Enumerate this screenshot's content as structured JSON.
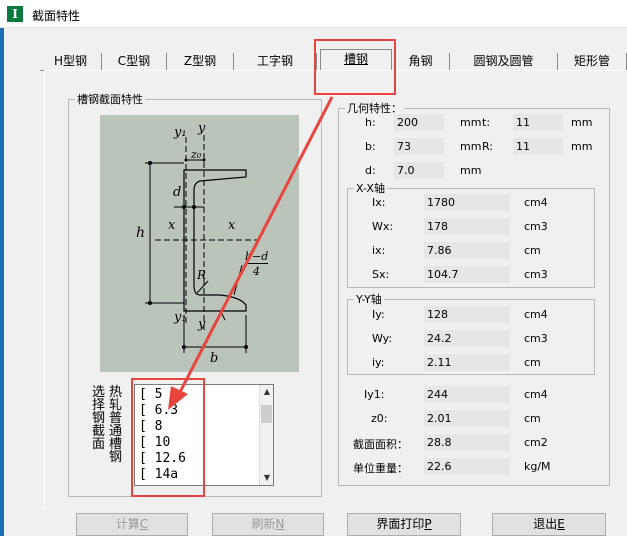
{
  "window": {
    "title": "截面特性",
    "icon_letter": "I"
  },
  "tabs": [
    {
      "label": "H型钢",
      "active": false
    },
    {
      "label": "C型钢",
      "active": false
    },
    {
      "label": "Z型钢",
      "active": false
    },
    {
      "label": "工字钢",
      "active": false
    },
    {
      "label": "槽钢",
      "active": true
    },
    {
      "label": "角钢",
      "active": false
    },
    {
      "label": "圆钢及圆管",
      "active": false
    },
    {
      "label": "矩形管",
      "active": false
    }
  ],
  "section_group": {
    "legend": "槽钢截面特性"
  },
  "diagram": {
    "labels": {
      "y1_top": "y₁",
      "y_top": "y",
      "z0": "z₀",
      "d": "d",
      "h": "h",
      "x_left": "x",
      "x_right": "x",
      "R": "R",
      "frac_top": "b−d",
      "frac_bottom": "4",
      "y1_bottom": "y₁",
      "y_bottom": "y",
      "b": "b"
    }
  },
  "list_side_label": [
    "选择钢截面",
    "热轧普通槽钢"
  ],
  "list_items": [
    "[  5",
    "[  6.3",
    "[  8",
    "[  10",
    "[  12.6",
    "[  14a"
  ],
  "geometry": {
    "legend": "几何特性：",
    "h": {
      "label": "h:",
      "value": "200",
      "unit": "mm"
    },
    "t": {
      "label": "t:",
      "value": "11",
      "unit": "mm"
    },
    "b": {
      "label": "b:",
      "value": "73",
      "unit": "mm"
    },
    "R": {
      "label": "R:",
      "value": "11",
      "unit": "mm"
    },
    "d": {
      "label": "d:",
      "value": "7.0",
      "unit": "mm"
    }
  },
  "xx_axis": {
    "legend": "X-X轴",
    "Ix": {
      "label": "Ix:",
      "value": "1780",
      "unit": "cm4"
    },
    "Wx": {
      "label": "Wx:",
      "value": "178",
      "unit": "cm3"
    },
    "ix": {
      "label": "ix:",
      "value": "7.86",
      "unit": "cm"
    },
    "Sx": {
      "label": "Sx:",
      "value": "104.7",
      "unit": "cm3"
    }
  },
  "yy_axis": {
    "legend": "Y-Y轴",
    "Iy": {
      "label": "Iy:",
      "value": "128",
      "unit": "cm4"
    },
    "Wy": {
      "label": "Wy:",
      "value": "24.2",
      "unit": "cm3"
    },
    "iy": {
      "label": "iy:",
      "value": "2.11",
      "unit": "cm"
    }
  },
  "others": {
    "Iy1": {
      "label": "Iy1:",
      "value": "244",
      "unit": "cm4"
    },
    "z0": {
      "label": "z0:",
      "value": "2.01",
      "unit": "cm"
    },
    "area": {
      "label": "截面面积：",
      "value": "28.8",
      "unit": "cm2"
    },
    "weight": {
      "label": "单位重量：",
      "value": "22.6",
      "unit": "kg/M"
    }
  },
  "buttons": [
    {
      "label": "计算",
      "key": "C",
      "enabled": false
    },
    {
      "label": "刷新",
      "key": "N",
      "enabled": false
    },
    {
      "label": "界面打印",
      "key": "P",
      "enabled": true
    },
    {
      "label": "退出",
      "key": "E",
      "enabled": true
    }
  ],
  "colors": {
    "annotation_red": "#e8453c",
    "diagram_bg": "#bbc4bb",
    "title_icon": "#0b7a3e"
  }
}
